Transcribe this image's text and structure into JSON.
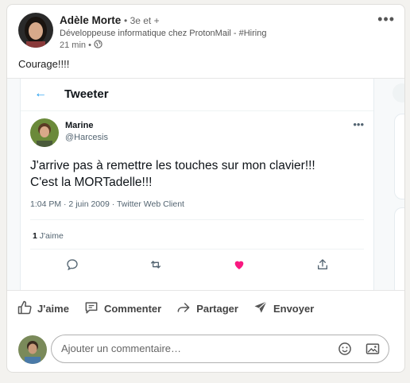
{
  "post": {
    "author_name": "Adèle Morte",
    "degree": "• 3e et +",
    "headline": "Développeuse informatique chez ProtonMail - #Hiring",
    "time": "21 min •",
    "more": "•••",
    "text": "Courage!!!!"
  },
  "tweet": {
    "back_glyph": "←",
    "header_title": "Tweeter",
    "author_name": "Marine",
    "handle": "@Harcesis",
    "more": "•••",
    "text_line1": "J'arrive pas à remettre les touches sur mon clavier!!!",
    "text_line2": "C'est la MORTadelle!!!",
    "meta": "1:04 PM · 2 juin 2009 · Twitter Web Client",
    "like_count": "1",
    "like_label": "J'aime",
    "accent_color": "#1d9bf0",
    "heart_color": "#f91880"
  },
  "actions": {
    "like": "J'aime",
    "comment": "Commenter",
    "share": "Partager",
    "send": "Envoyer"
  },
  "comment": {
    "placeholder": "Ajouter un commentaire…"
  }
}
